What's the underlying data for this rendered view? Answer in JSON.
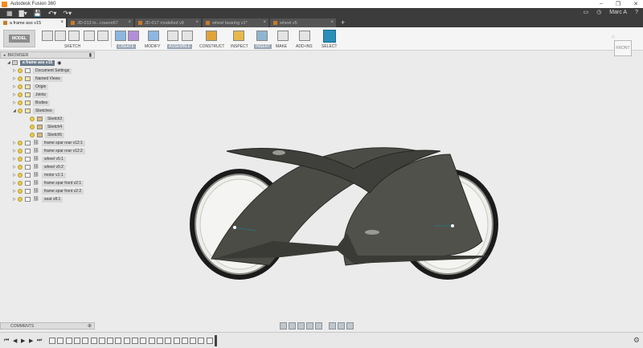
{
  "window": {
    "title": "Autodesk Fusion 360"
  },
  "quickbar": {
    "user": "Marc A"
  },
  "tabs": [
    {
      "label": "a frame ass v15",
      "active": true
    },
    {
      "label": "JD-013 lo...coaxre67"
    },
    {
      "label": "JD-017 modelled v8"
    },
    {
      "label": "wheel bearing v1*"
    },
    {
      "label": "wheel v5"
    }
  ],
  "toolbar": {
    "workspace": "MODEL",
    "groups": [
      "SKETCH",
      "CREATE",
      "MODIFY",
      "ASSEMBLE",
      "CONSTRUCT",
      "INSPECT",
      "INSERT",
      "MAKE",
      "ADD-INS",
      "SELECT"
    ]
  },
  "browser": {
    "header": "BROWSER",
    "root": "a frame ass v15",
    "items": [
      {
        "label": "Document Settings",
        "kind": "gear",
        "indent": 1,
        "tri": "▷"
      },
      {
        "label": "Named Views",
        "kind": "folder",
        "indent": 1,
        "tri": "▷"
      },
      {
        "label": "Origin",
        "kind": "folder",
        "indent": 1,
        "tri": "▷"
      },
      {
        "label": "Joints",
        "kind": "folder",
        "indent": 1,
        "tri": "▷"
      },
      {
        "label": "Bodies",
        "kind": "folder",
        "indent": 1,
        "tri": "▷"
      },
      {
        "label": "Sketches",
        "kind": "folder",
        "indent": 1,
        "tri": "◢"
      },
      {
        "label": "Sketch3",
        "kind": "sketch",
        "indent": 2,
        "tri": ""
      },
      {
        "label": "Sketch4",
        "kind": "sketch",
        "indent": 2,
        "tri": ""
      },
      {
        "label": "Sketch5",
        "kind": "sketch",
        "indent": 2,
        "tri": ""
      },
      {
        "label": "frame spar rear v12:1",
        "kind": "comp",
        "indent": 1,
        "tri": "▷"
      },
      {
        "label": "frame spar rear v12:2",
        "kind": "comp",
        "indent": 1,
        "tri": "▷"
      },
      {
        "label": "wheel v5:1",
        "kind": "comp",
        "indent": 1,
        "tri": "▷"
      },
      {
        "label": "wheel v5:2",
        "kind": "comp",
        "indent": 1,
        "tri": "▷"
      },
      {
        "label": "motor v1:1",
        "kind": "comp",
        "indent": 1,
        "tri": "▷"
      },
      {
        "label": "frame spar front v2:1",
        "kind": "comp",
        "indent": 1,
        "tri": "▷"
      },
      {
        "label": "frame spar front v2:2",
        "kind": "comp",
        "indent": 1,
        "tri": "▷"
      },
      {
        "label": "seat v8:1",
        "kind": "comp",
        "indent": 1,
        "tri": "▷"
      }
    ]
  },
  "comments": {
    "label": "COMMENTS"
  },
  "viewcube": {
    "face": "FRONT"
  },
  "colors": {
    "dark": "#3c3c3c",
    "panel": "#f5f5f5",
    "canvas": "#ebebeb",
    "body": "#4a4a46",
    "selected_tab": "#f3f3f3"
  }
}
